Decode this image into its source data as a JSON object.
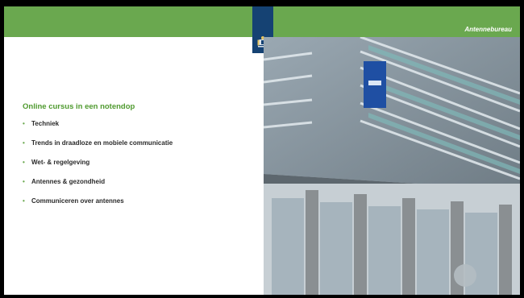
{
  "header": {
    "brand": "Antennebureau",
    "accent_color": "#6aa84f",
    "logo_color": "#154273",
    "logo_icon": "rijksoverheid-emblem-icon"
  },
  "content": {
    "title": "Online cursus in een notendop",
    "items": [
      {
        "label": "Techniek"
      },
      {
        "label": "Trends in draadloze en mobiele communicatie"
      },
      {
        "label": "Wet- & regelgeving"
      },
      {
        "label": "Antennes & gezondheid"
      },
      {
        "label": "Communiceren over antennes"
      }
    ],
    "bullet_glyph": "•"
  },
  "photo": {
    "icon": "office-building-photo"
  }
}
